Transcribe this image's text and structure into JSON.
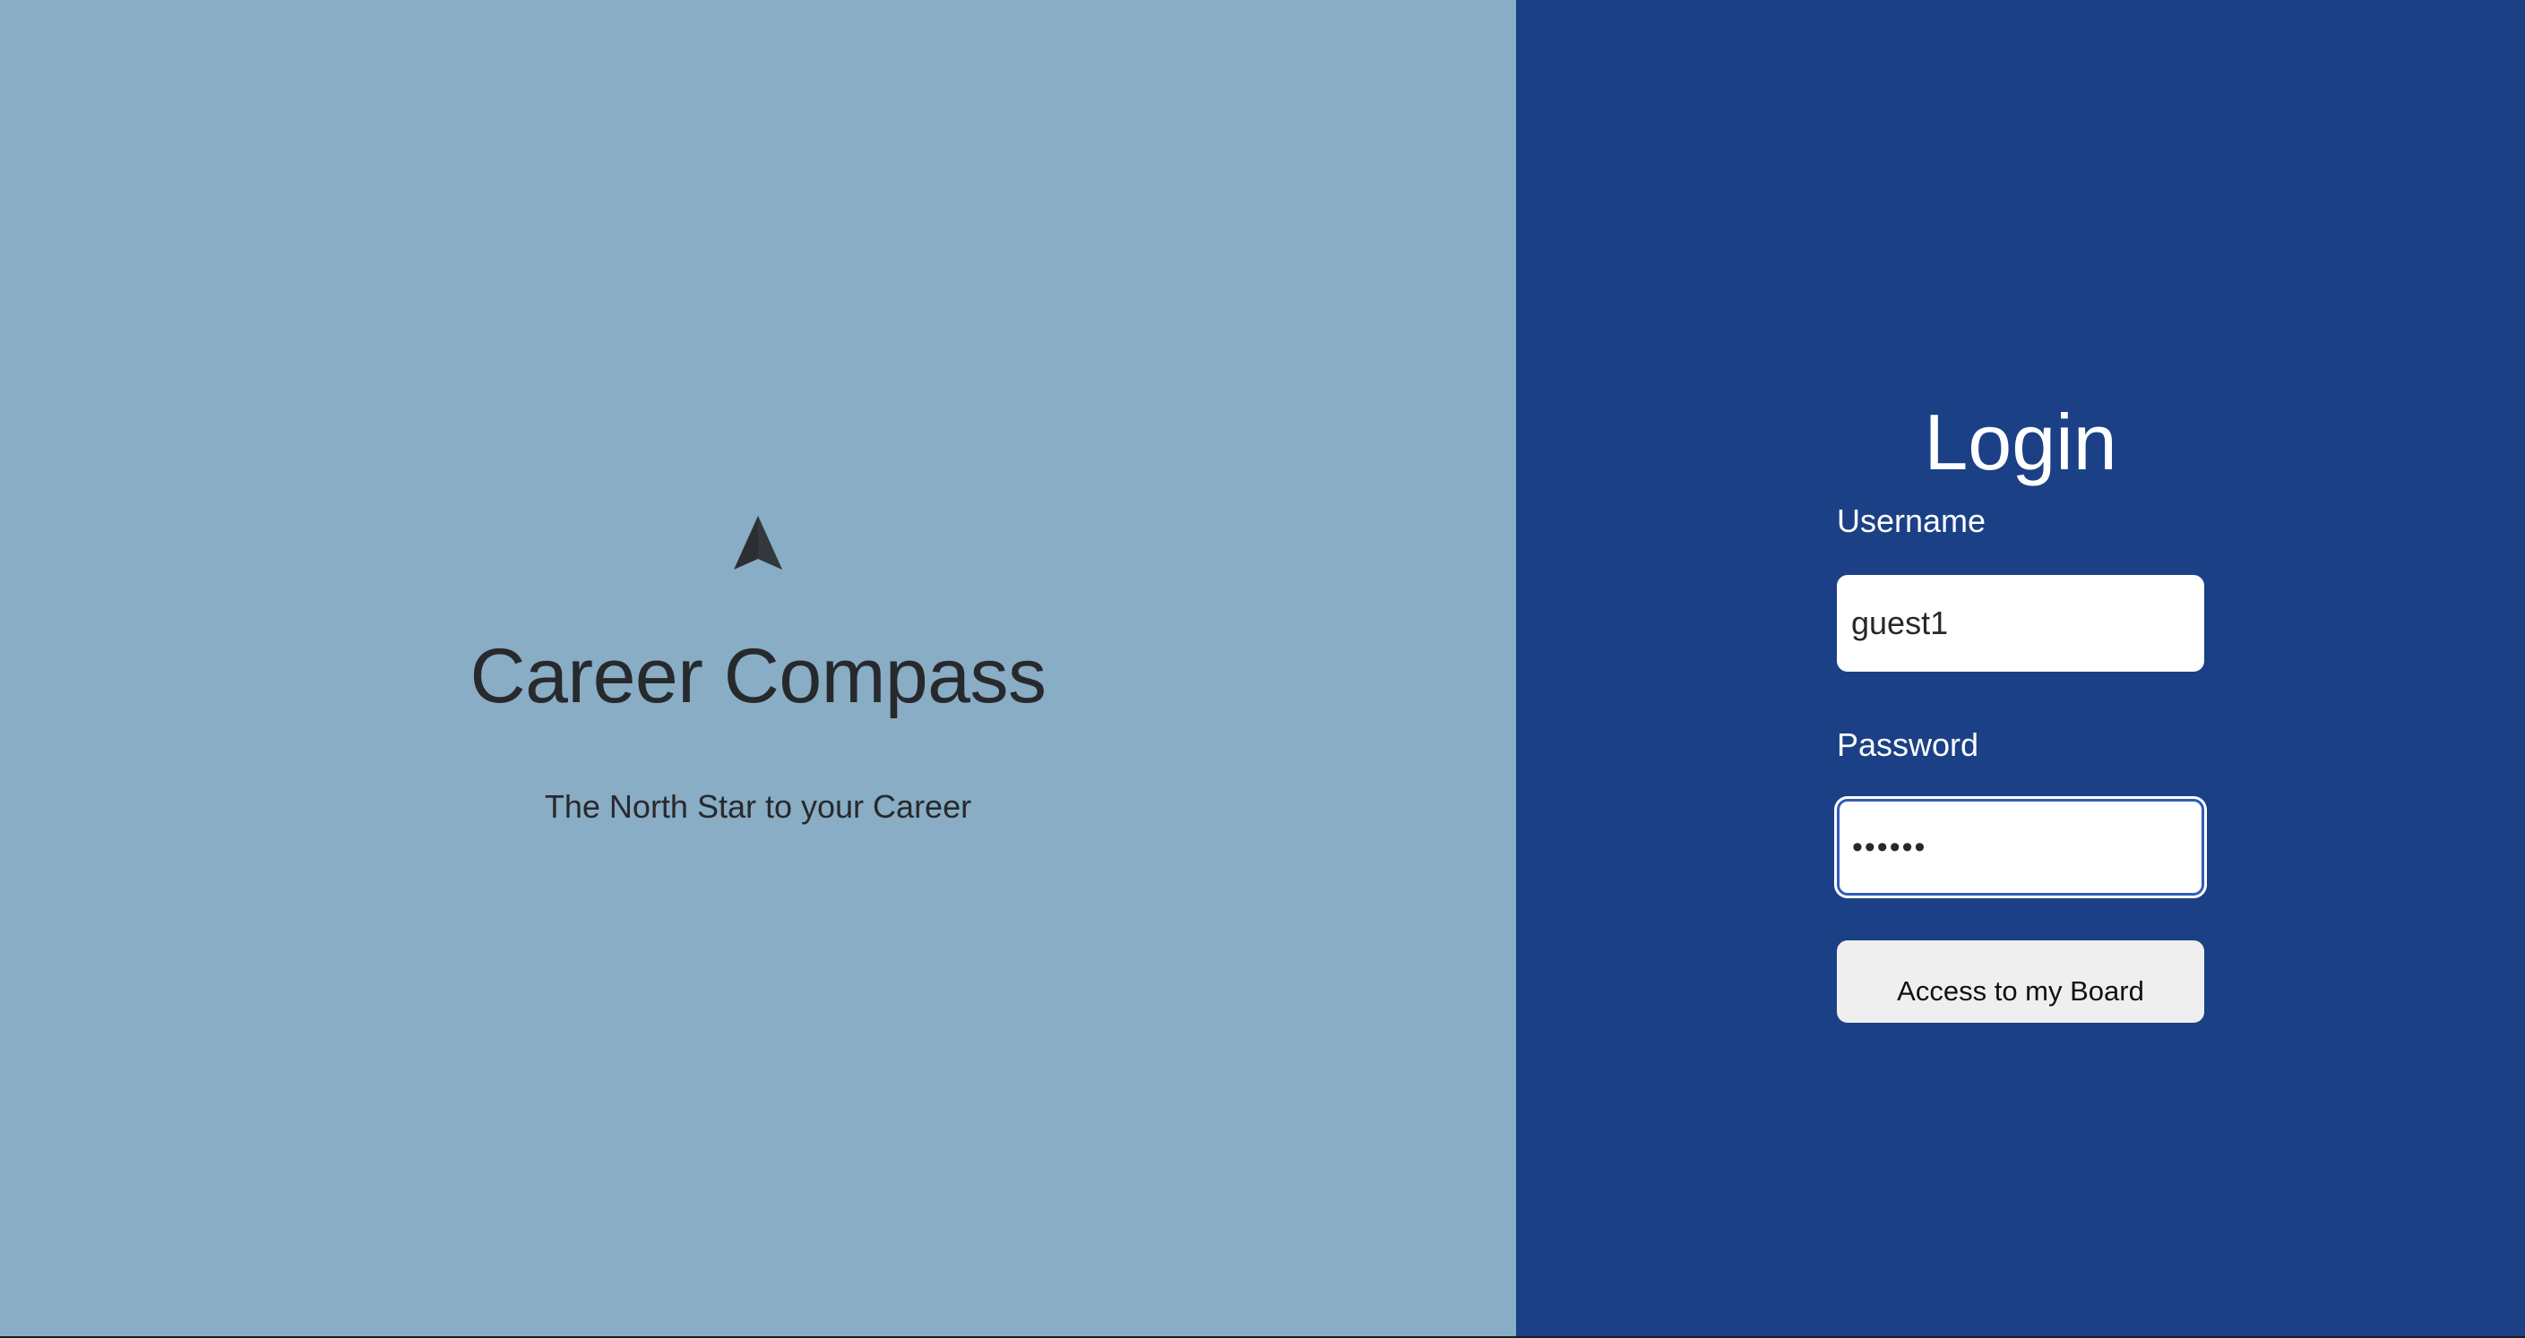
{
  "brand": {
    "logo_icon": "compass-arrow-icon",
    "title": "Career Compass",
    "tagline": "The North Star to your Career"
  },
  "login": {
    "title": "Login",
    "username_label": "Username",
    "username_value": "guest1",
    "password_label": "Password",
    "password_masked": "••••••",
    "submit_label": "Access to my Board"
  },
  "colors": {
    "left_background": "#88adc4",
    "right_background": "#1b4086",
    "brand_text": "#27292c",
    "button_background": "#efefef",
    "focus_border": "#2f5db8"
  }
}
